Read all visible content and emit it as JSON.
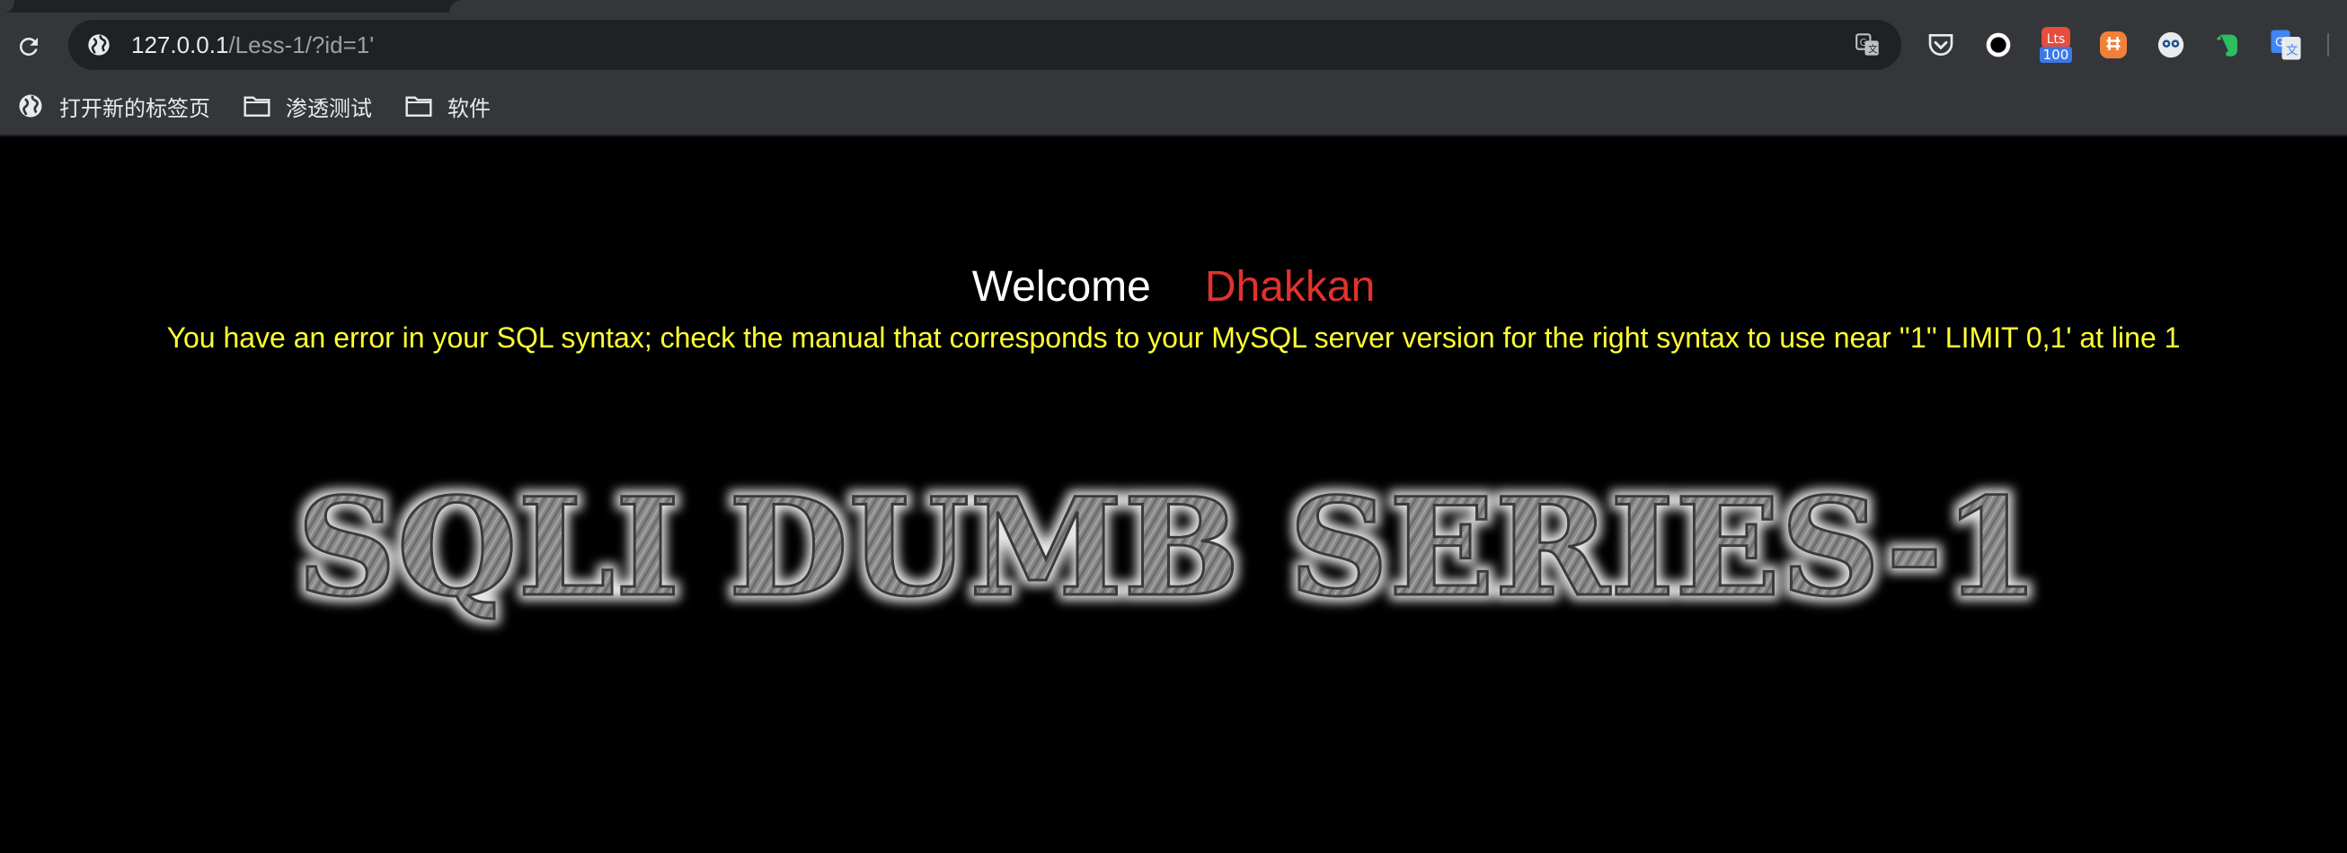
{
  "browser": {
    "url_host": "127.0.0.1",
    "url_path": "/Less-1/?id=1'",
    "bookmarks": [
      {
        "label": "打开新的标签页",
        "icon": "globe-icon"
      },
      {
        "label": "渗透测试",
        "icon": "folder-icon"
      },
      {
        "label": "软件",
        "icon": "folder-icon"
      }
    ],
    "extensions": [
      {
        "name": "pocket-icon"
      },
      {
        "name": "circle-record-icon"
      },
      {
        "name": "badge-extension-icon",
        "badge": "100"
      },
      {
        "name": "smile-extension-icon"
      },
      {
        "name": "owl-extension-icon"
      },
      {
        "name": "evernote-icon"
      },
      {
        "name": "google-translate-icon"
      }
    ]
  },
  "page": {
    "welcome": "Welcome",
    "user": "Dhakkan",
    "error": "You have an error in your SQL syntax; check the manual that corresponds to your MySQL server version for the right syntax to use near ''1'' LIMIT 0,1' at line 1",
    "banner": "SQLI DUMB SERIES-1"
  },
  "colors": {
    "page_bg": "#000000",
    "welcome": "#ffffff",
    "user": "#e0322e",
    "error": "#ffff33",
    "chrome_bg": "#35363a",
    "omnibox_bg": "#202124"
  }
}
